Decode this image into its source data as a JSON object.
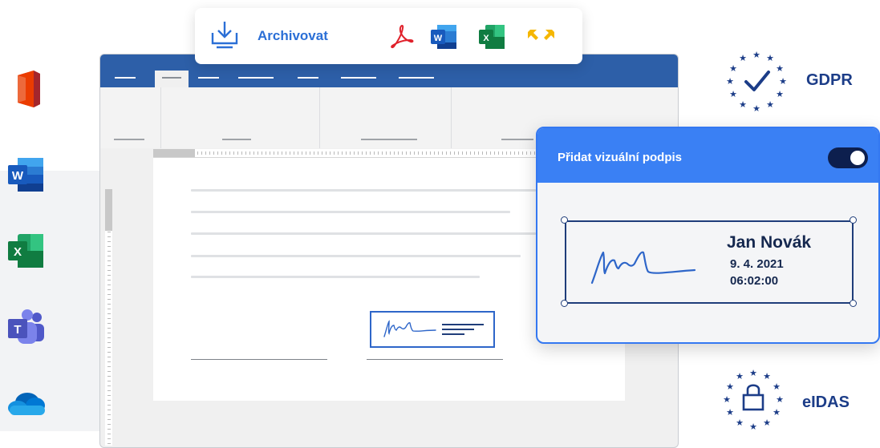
{
  "toolbar": {
    "archive_label": "Archivovat",
    "formats": [
      "pdf-icon",
      "word-icon",
      "excel-icon",
      "arrows-expand-icon"
    ]
  },
  "left_apps": [
    "office-icon",
    "word-icon",
    "excel-icon",
    "teams-icon",
    "onedrive-icon"
  ],
  "badges": {
    "gdpr_label": "GDPR",
    "eidas_label": "eIDAS"
  },
  "signature_panel": {
    "title": "Přidat vizuální podpis",
    "toggle_on": true,
    "name": "Jan Novák",
    "date": "9. 4. 2021",
    "time": "06:02:00"
  },
  "colors": {
    "accent_blue": "#3a80f4",
    "titlebar_blue": "#2d5fa8",
    "navy": "#1c3d88",
    "signature_blue": "#2e66c9"
  }
}
